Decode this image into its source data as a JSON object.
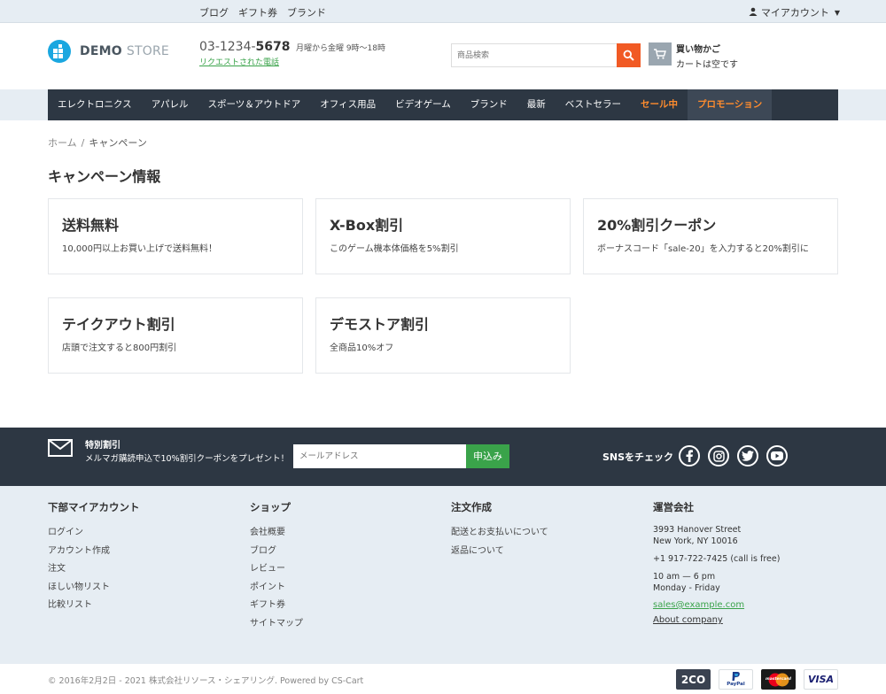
{
  "topbar": {
    "links": [
      "ブログ",
      "ギフト券",
      "ブランド"
    ],
    "account_label": "マイアカウント"
  },
  "header": {
    "logo_bold": "DEMO",
    "logo_light": "STORE",
    "phone_prefix": "03-1234-",
    "phone_bold": "5678",
    "phone_hours": "月曜から金曜 9時～18時",
    "callback_link": "リクエストされた電話",
    "search_placeholder": "商品検索",
    "cart_title": "買い物かご",
    "cart_status": "カートは空です"
  },
  "nav": {
    "items": [
      "エレクトロニクス",
      "アパレル",
      "スポーツ＆アウトドア",
      "オフィス用品",
      "ビデオゲーム",
      "ブランド",
      "最新",
      "ベストセラー"
    ],
    "sale": "セール中",
    "promo": "プロモーション"
  },
  "breadcrumb": {
    "home": "ホーム",
    "separator": "/",
    "current": "キャンペーン"
  },
  "page_title": "キャンペーン情報",
  "campaigns": [
    {
      "title": "送料無料",
      "desc": "10,000円以上お買い上げで送料無料！"
    },
    {
      "title": "X-Box割引",
      "desc": "このゲーム機本体価格を5%割引"
    },
    {
      "title": "20%割引クーポン",
      "desc": "ボーナスコード「sale-20」を入力すると20%割引に"
    },
    {
      "title": "テイクアウト割引",
      "desc": "店頭で注文すると800円割引"
    },
    {
      "title": "デモストア割引",
      "desc": "全商品10%オフ"
    }
  ],
  "newsletter": {
    "title": "特別割引",
    "desc": "メルマガ購読申込で10%割引クーポンをプレゼント！",
    "placeholder": "メールアドレス",
    "button": "申込み",
    "sns_label": "SNSをチェック"
  },
  "footer": {
    "col1": {
      "title": "下部マイアカウント",
      "links": [
        "ログイン",
        "アカウント作成",
        "注文",
        "ほしい物リスト",
        "比較リスト"
      ]
    },
    "col2": {
      "title": "ショップ",
      "links": [
        "会社概要",
        "ブログ",
        "レビュー",
        "ポイント",
        "ギフト券",
        "サイトマップ"
      ]
    },
    "col3": {
      "title": "注文作成",
      "links": [
        "配送とお支払いについて",
        "返品について"
      ]
    },
    "col4": {
      "title": "運営会社",
      "address1": "3993 Hanover Street",
      "address2": "New York, NY 10016",
      "phone": "+1 917-722-7425 (call is free)",
      "hours1": "10 am — 6 pm",
      "hours2": "Monday - Friday",
      "email": "sales@example.com",
      "about": "About company"
    }
  },
  "bottom": {
    "copyright": "© 2016年2月2日 - 2021 株式会社リソース・シェアリング.  Powered by CS-Cart",
    "payments": [
      "2CO",
      "PayPal",
      "mastercard",
      "VISA"
    ]
  },
  "colors": {
    "nav_bg": "#2d3743",
    "accent_orange": "#f15a24",
    "sale_orange": "#ff8c2e",
    "green": "#3aa34a",
    "logo_blue": "#1aa7e0"
  }
}
